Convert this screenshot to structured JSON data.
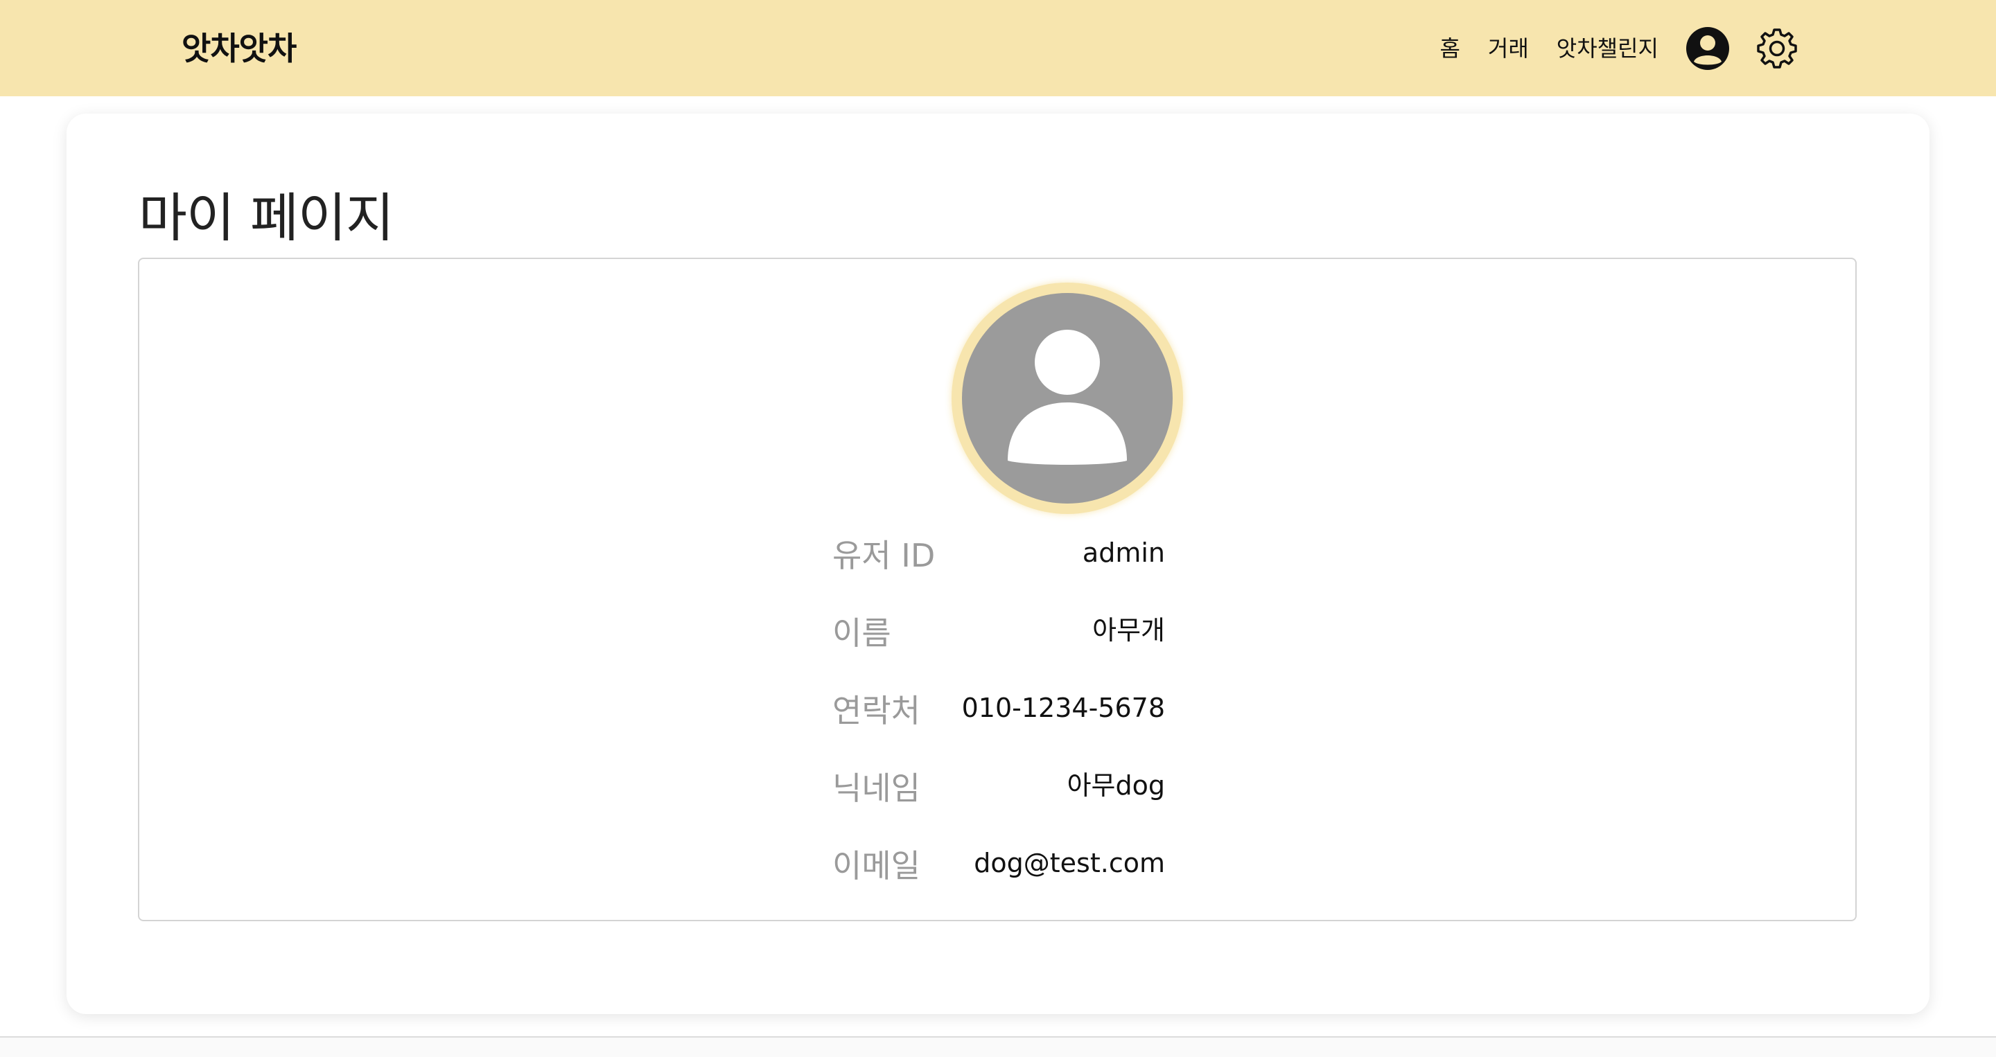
{
  "header": {
    "brand": "앗차앗차",
    "nav": {
      "home": "홈",
      "trade": "거래",
      "challenge": "앗차챌린지"
    },
    "icons": {
      "profile": "user-circle-icon",
      "settings": "gear-icon"
    },
    "background_color": "#f7e5ae"
  },
  "main": {
    "title": "마이 페이지",
    "avatar": {
      "icon": "default-user-avatar-icon",
      "ring_color": "#f7e5ae",
      "fill_color": "#9b9b9b"
    },
    "fields": [
      {
        "label": "유저 ID",
        "value": "admin"
      },
      {
        "label": "이름",
        "value": "아무개"
      },
      {
        "label": "연락처",
        "value": "010-1234-5678"
      },
      {
        "label": "닉네임",
        "value": "아무dog"
      },
      {
        "label": "이메일",
        "value": "dog@test.com"
      }
    ]
  }
}
